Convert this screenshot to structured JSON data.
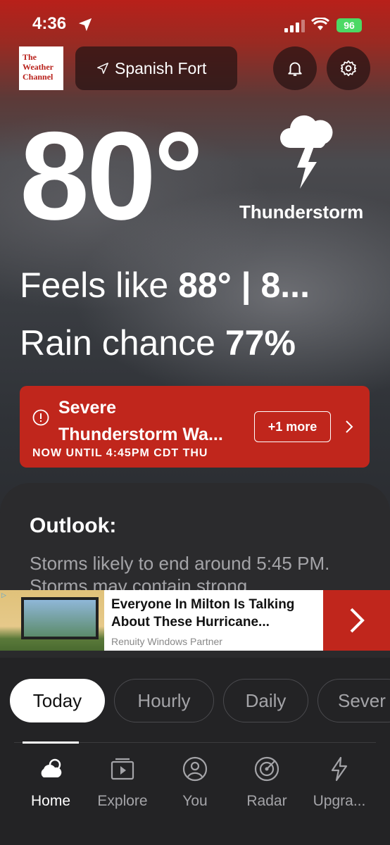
{
  "status_bar": {
    "time": "4:36",
    "battery": "96"
  },
  "header": {
    "logo_lines": [
      "The",
      "Weather",
      "Channel"
    ],
    "location": "Spanish Fort"
  },
  "current": {
    "temperature": "80°",
    "condition": "Thunderstorm",
    "feels_like_label": "Feels like ",
    "feels_like_value": "88°",
    "feels_like_rest": "  |  8...",
    "rain_label": "Rain chance ",
    "rain_value": "77%"
  },
  "alert": {
    "title_line1": "Severe",
    "title_line2": "Thunderstorm Wa...",
    "more_label": "+1 more",
    "subtitle": "NOW UNTIL 4:45PM CDT THU"
  },
  "outlook": {
    "title": "Outlook:",
    "text": "Storms likely to end around 5:45 PM. Storms may contain strong"
  },
  "ad": {
    "title_line1": "Everyone In Milton Is Talking",
    "title_line2": "About These Hurricane...",
    "source": "Renuity Windows Partner"
  },
  "tabs": [
    "Today",
    "Hourly",
    "Daily",
    "Sever"
  ],
  "nav": [
    "Home",
    "Explore",
    "You",
    "Radar",
    "Upgra..."
  ],
  "colors": {
    "accent": "#c0261c",
    "card": "#2b2b2d",
    "muted": "#a4a4a8"
  }
}
